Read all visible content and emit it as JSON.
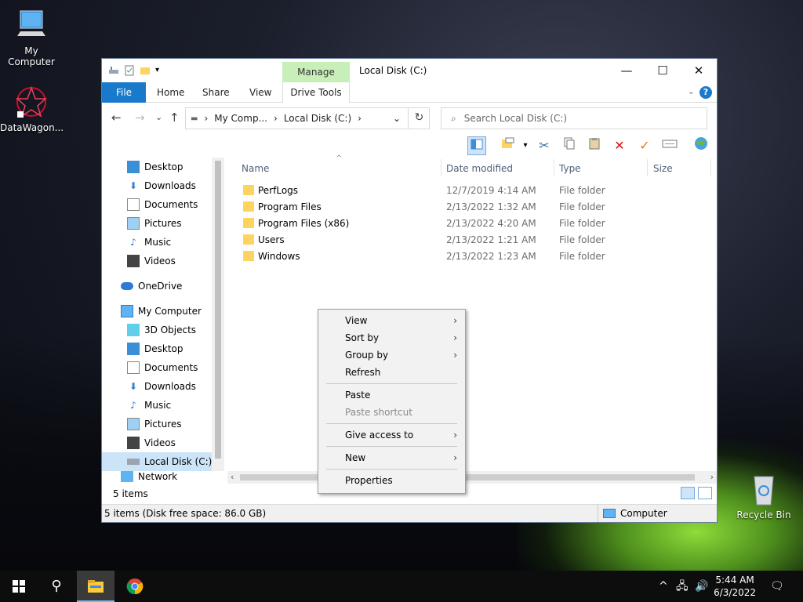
{
  "desktop": {
    "icons": [
      {
        "label": "My Computer"
      },
      {
        "label": "DataWagon..."
      },
      {
        "label": "Recycle Bin"
      }
    ]
  },
  "window": {
    "title": "Local Disk (C:)",
    "manage_label": "Manage",
    "ribbon_tabs": {
      "file": "File",
      "home": "Home",
      "share": "Share",
      "view": "View",
      "drive_tools": "Drive Tools"
    },
    "help": "?"
  },
  "nav": {
    "breadcrumb": [
      "My Comp...",
      "Local Disk (C:)"
    ],
    "search_placeholder": "Search Local Disk (C:)"
  },
  "sidebar": {
    "quick": [
      {
        "label": "Desktop",
        "icon": "desktop-icon"
      },
      {
        "label": "Downloads",
        "icon": "downloads-icon"
      },
      {
        "label": "Documents",
        "icon": "documents-icon"
      },
      {
        "label": "Pictures",
        "icon": "pictures-icon"
      },
      {
        "label": "Music",
        "icon": "music-icon"
      },
      {
        "label": "Videos",
        "icon": "videos-icon"
      }
    ],
    "onedrive": "OneDrive",
    "computer": "My Computer",
    "computer_items": [
      {
        "label": "3D Objects"
      },
      {
        "label": "Desktop"
      },
      {
        "label": "Documents"
      },
      {
        "label": "Downloads"
      },
      {
        "label": "Music"
      },
      {
        "label": "Pictures"
      },
      {
        "label": "Videos"
      },
      {
        "label": "Local Disk (C:)"
      }
    ],
    "network": "Network"
  },
  "files": {
    "columns": {
      "name": "Name",
      "date": "Date modified",
      "type": "Type",
      "size": "Size"
    },
    "rows": [
      {
        "name": "PerfLogs",
        "date": "12/7/2019 4:14 AM",
        "type": "File folder"
      },
      {
        "name": "Program Files",
        "date": "2/13/2022 1:32 AM",
        "type": "File folder"
      },
      {
        "name": "Program Files (x86)",
        "date": "2/13/2022 4:20 AM",
        "type": "File folder"
      },
      {
        "name": "Users",
        "date": "2/13/2022 1:21 AM",
        "type": "File folder"
      },
      {
        "name": "Windows",
        "date": "2/13/2022 1:23 AM",
        "type": "File folder"
      }
    ]
  },
  "items_count": "5 items",
  "status": {
    "left": "5 items (Disk free space: 86.0 GB)",
    "right": "Computer"
  },
  "context_menu": {
    "view": "View",
    "sort_by": "Sort by",
    "group_by": "Group by",
    "refresh": "Refresh",
    "paste": "Paste",
    "paste_shortcut": "Paste shortcut",
    "give_access": "Give access to",
    "new": "New",
    "properties": "Properties"
  },
  "taskbar": {
    "time": "5:44 AM",
    "date": "6/3/2022"
  }
}
